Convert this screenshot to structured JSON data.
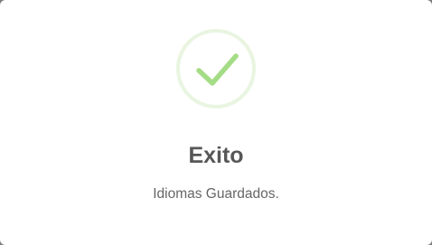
{
  "dialog": {
    "icon": "success-check-icon",
    "title": "Exito",
    "message": "Idiomas Guardados."
  },
  "colors": {
    "success_check": "#a5dc86",
    "success_ring": "#e9f5e1",
    "title_text": "#575757",
    "message_text": "#666666"
  }
}
